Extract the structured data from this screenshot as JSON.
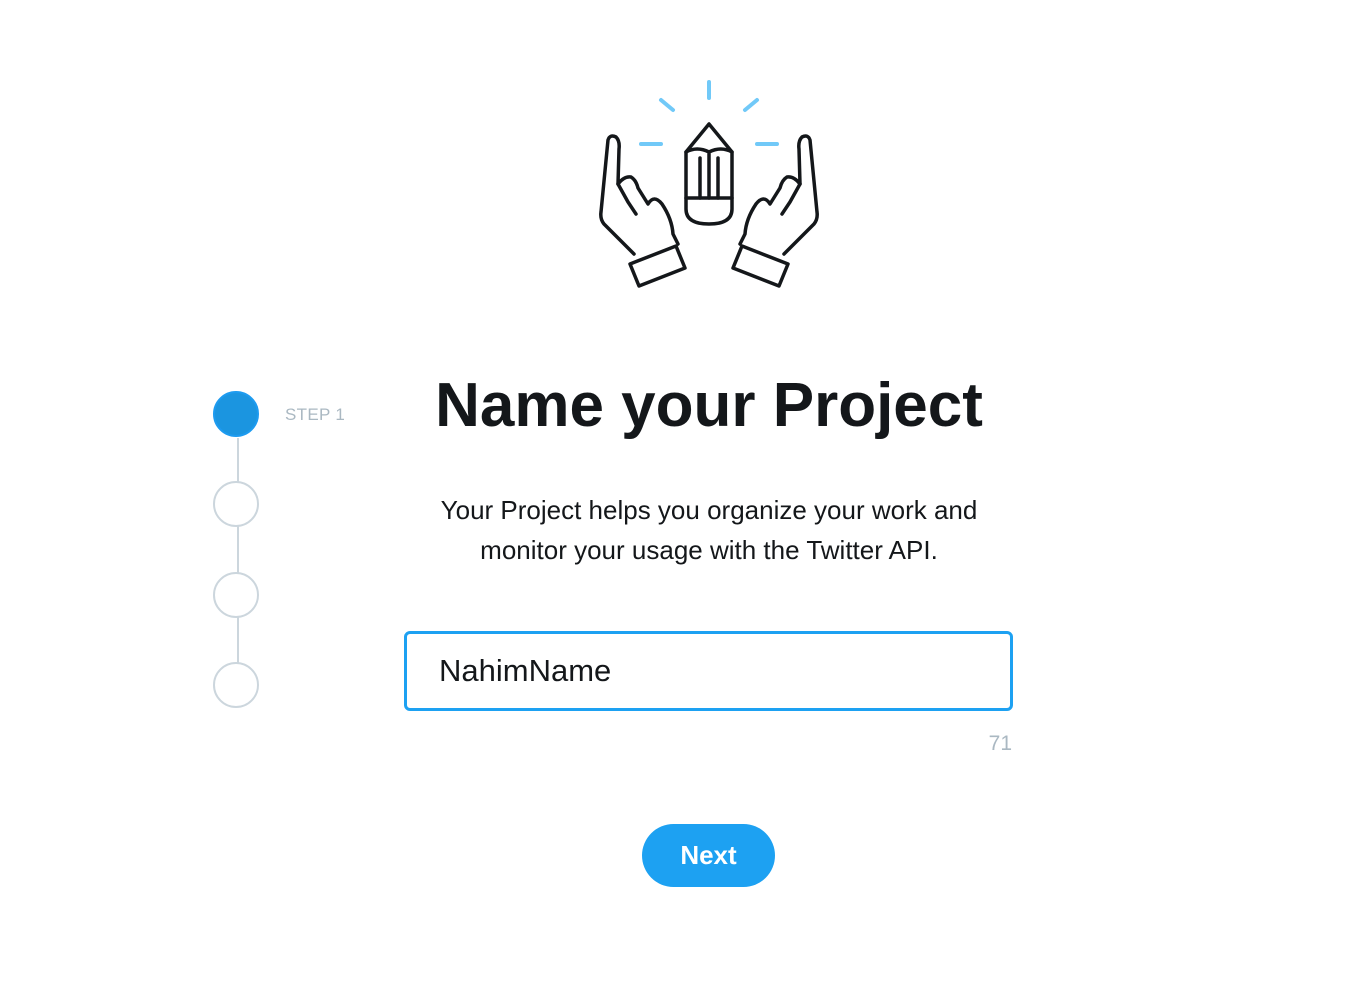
{
  "stepper": {
    "current_step_label": "STEP 1",
    "total_steps": 4,
    "current_step": 1
  },
  "page": {
    "title": "Name your Project",
    "description_line1": "Your Project helps you organize your work and",
    "description_line2": "monitor your usage with the Twitter API."
  },
  "project_name_input": {
    "value": "NahimName",
    "remaining_chars": "71"
  },
  "actions": {
    "next_label": "Next"
  },
  "colors": {
    "accent": "#1da1f2",
    "active_step": "#1b95e0",
    "muted_text": "#aab8c2",
    "inactive_step_border": "#ccd6dd",
    "illustration_sparkles": "#71c9f8",
    "text": "#14171a"
  },
  "icons": {
    "illustration": "hands-holding-pencil-icon"
  }
}
